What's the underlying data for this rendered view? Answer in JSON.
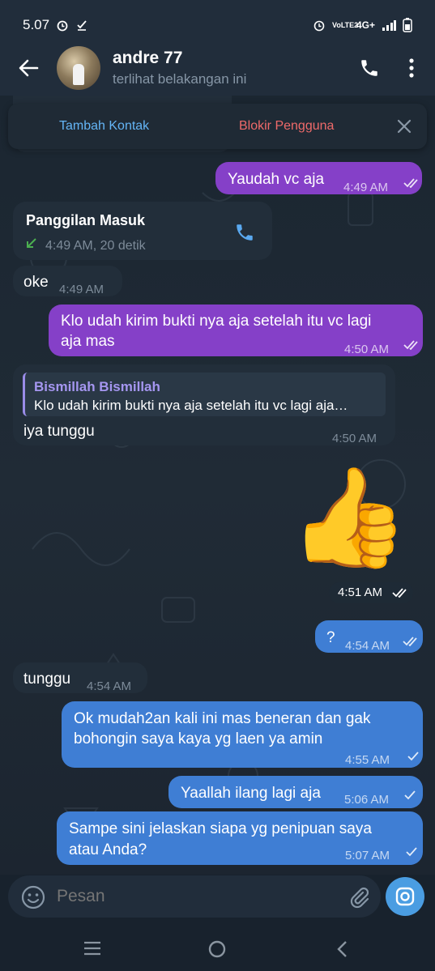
{
  "statusbar": {
    "time": "5.07",
    "network": "4G+",
    "volte": "VoLTE2"
  },
  "header": {
    "name": "andre 77",
    "status": "terlihat belakangan ini"
  },
  "actionbar": {
    "add_contact": "Tambah Kontak",
    "block_user": "Blokir Pengguna"
  },
  "messages": {
    "m1": {
      "text": "Yaudah vc aja",
      "time": "4:49 AM"
    },
    "call": {
      "title": "Panggilan Masuk",
      "detail": "4:49 AM, 20 detik"
    },
    "m2": {
      "text": "oke",
      "time": "4:49 AM"
    },
    "m3": {
      "line1": "Klo udah kirim bukti nya aja setelah itu vc lagi",
      "line2": "aja mas",
      "time": "4:50 AM"
    },
    "m4": {
      "reply_name": "Bismillah Bismillah",
      "reply_text": "Klo udah kirim bukti nya aja setelah itu vc lagi aja…",
      "text": "iya tunggu",
      "time": "4:50 AM"
    },
    "sticker": {
      "emoji": "👍",
      "time": "4:51 AM"
    },
    "m5": {
      "text": "?",
      "time": "4:54 AM"
    },
    "m6": {
      "text": "tunggu",
      "time": "4:54 AM"
    },
    "m7": {
      "line1": "Ok mudah2an kali ini mas beneran dan gak",
      "line2": "bohongin saya kaya yg laen ya amin",
      "time": "4:55 AM"
    },
    "m8": {
      "text": "Yaallah ilang lagi aja",
      "time": "5:06 AM"
    },
    "m9": {
      "line1": "Sampe sini jelaskan siapa yg penipuan saya",
      "line2": "atau Anda?",
      "time": "5:07 AM"
    }
  },
  "input": {
    "placeholder": "Pesan"
  },
  "colors": {
    "purple_bubble": "#8540c8",
    "blue_bubble": "#3f7ed4",
    "incoming_bubble": "#222e3a",
    "accent": "#64b5f6",
    "danger": "#ef6a6a"
  }
}
